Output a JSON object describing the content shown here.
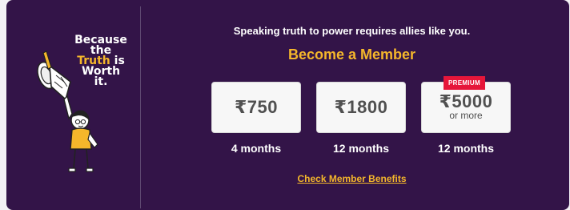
{
  "slogan": {
    "line1": "Because",
    "line2": "the",
    "truth_word": "Truth",
    "is_word": " is",
    "line4": "Worth",
    "line5": "it."
  },
  "subtitle": "Speaking truth to power requires allies like you.",
  "heading": "Become a Member",
  "plans": [
    {
      "price": "₹750",
      "note": "",
      "duration": "4 months",
      "badge": ""
    },
    {
      "price": "₹1800",
      "note": "",
      "duration": "12 months",
      "badge": ""
    },
    {
      "price": "₹5000",
      "note": "or more",
      "duration": "12 months",
      "badge": "PREMIUM"
    }
  ],
  "benefits_link": "Check Member Benefits",
  "colors": {
    "background": "#331448",
    "accent": "#f5b72b",
    "badge": "#e6163a",
    "card": "#f7f7f7"
  },
  "icons": {
    "illustration": "girl-holding-megaphone-illustration"
  }
}
